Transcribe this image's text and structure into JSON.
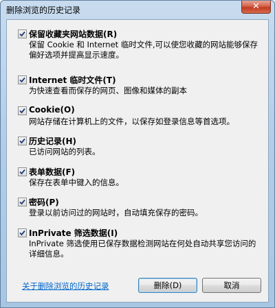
{
  "window": {
    "title": "删除浏览的历史记录",
    "close_label": "✕"
  },
  "options": [
    {
      "title": "保留收藏夹网站数据(R)",
      "desc": "保留 Cookie 和 Internet 临时文件,可以使您收藏的网站能够保存偏好选项并提高显示速度。",
      "checked": true
    },
    {
      "title": "Internet 临时文件(T)",
      "desc": "为快速查看而保存的网页、图像和媒体的副本",
      "checked": true
    },
    {
      "title": "Cookie(O)",
      "desc": "网站存储在计算机上的文件，以保存如登录信息等首选项。",
      "checked": true
    },
    {
      "title": "历史记录(H)",
      "desc": "已访问网站的列表。",
      "checked": true
    },
    {
      "title": "表单数据(F)",
      "desc": "保存在表单中键入的信息。",
      "checked": true
    },
    {
      "title": "密码(P)",
      "desc": "登录以前访问过的网站时，自动填充保存的密码。",
      "checked": true
    },
    {
      "title": "InPrivate 筛选数据(I)",
      "desc": "InPrivate 筛选使用已保存数据检测网站在何处自动共享您访问的详细信息。",
      "checked": true
    }
  ],
  "footer": {
    "help_link": "关于删除浏览的历史记录",
    "delete_label": "删除(D)",
    "cancel_label": "取消"
  }
}
